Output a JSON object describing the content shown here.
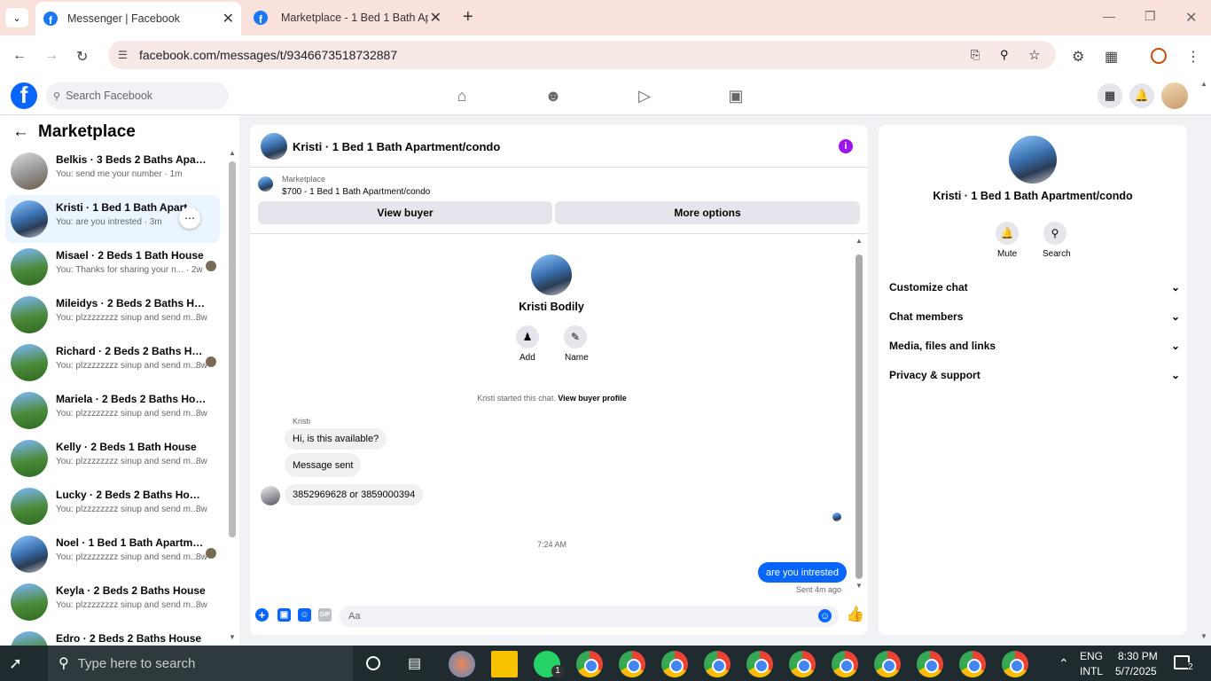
{
  "browser": {
    "tabs": [
      {
        "title": "Messenger | Facebook",
        "active": true
      },
      {
        "title": "Marketplace - 1 Bed 1 Bath Apa",
        "active": false
      }
    ],
    "url": "facebook.com/messages/t/9346673518732887"
  },
  "fb": {
    "search_placeholder": "Search Facebook"
  },
  "left": {
    "title": "Marketplace",
    "conversations": [
      {
        "name": "Belkis · 3 Beds 2 Baths Apartme...",
        "preview": "You: send me your number · 1m",
        "time": "",
        "avatar": "interior"
      },
      {
        "name": "Kristi · 1 Bed 1 Bath Apartme...",
        "preview": "You: are you intrested · 3m",
        "time": "",
        "avatar": "apartment",
        "selected": true
      },
      {
        "name": "Misael · 2 Beds 1 Bath House",
        "preview": "You: Thanks for sharing your n... · 2w",
        "time": "",
        "avatar": "house"
      },
      {
        "name": "Mileidys · 2 Beds 2 Baths House",
        "preview": "You: plzzzzzzzz sinup and send m...",
        "time": "8w",
        "avatar": "house"
      },
      {
        "name": "Richard · 2 Beds 2 Baths House",
        "preview": "You: plzzzzzzzz sinup and send m...",
        "time": "8w",
        "avatar": "house"
      },
      {
        "name": "Mariela · 2 Beds 2 Baths House",
        "preview": "You: plzzzzzzzz sinup and send m...",
        "time": "8w",
        "avatar": "house"
      },
      {
        "name": "Kelly · 2 Beds 1 Bath House",
        "preview": "You: plzzzzzzzz sinup and send m...",
        "time": "8w",
        "avatar": "house"
      },
      {
        "name": "Lucky · 2 Beds 2 Baths House",
        "preview": "You: plzzzzzzzz sinup and send m...",
        "time": "8w",
        "avatar": "house"
      },
      {
        "name": "Noel · 1 Bed 1 Bath Apartmen...",
        "preview": "You: plzzzzzzzz sinup and send m...",
        "time": "8w",
        "avatar": "apartment"
      },
      {
        "name": "Keyla · 2 Beds 2 Baths House",
        "preview": "You: plzzzzzzzz sinup and send m...",
        "time": "8w",
        "avatar": "house"
      },
      {
        "name": "Edro · 2 Beds 2 Baths House",
        "preview": "",
        "time": "",
        "avatar": "house"
      }
    ]
  },
  "chat": {
    "title": "Kristi · 1 Bed 1 Bath Apartment/condo",
    "marketplace_label": "Marketplace",
    "listing": "$700 - 1 Bed 1 Bath Apartment/condo",
    "view_buyer": "View buyer",
    "more_options": "More options",
    "profile_name": "Kristi Bodily",
    "add_label": "Add",
    "name_label": "Name",
    "started_text": "Kristi started this chat.",
    "view_profile": "View buyer profile",
    "sender": "Kristi",
    "messages": [
      "Hi, is this available?",
      "Message sent",
      "3852969628 or 3859000394"
    ],
    "time_divider": "7:24 AM",
    "my_message": "are you intrested",
    "sent_status": "Sent 4m ago",
    "composer_placeholder": "Aa"
  },
  "info": {
    "title": "Kristi · 1 Bed 1 Bath Apartment/condo",
    "mute": "Mute",
    "search": "Search",
    "sections": [
      "Customize chat",
      "Chat members",
      "Media, files and links",
      "Privacy & support"
    ]
  },
  "taskbar": {
    "search_placeholder": "Type here to search",
    "lang1": "ENG",
    "lang2": "INTL",
    "time": "8:30 PM",
    "date": "5/7/2025",
    "whatsapp_badge": "1",
    "notif_count": "2"
  },
  "colors": {
    "fb_blue": "#0866ff",
    "info_purple": "#a112f0",
    "tab_strip": "#f9e1dc"
  }
}
